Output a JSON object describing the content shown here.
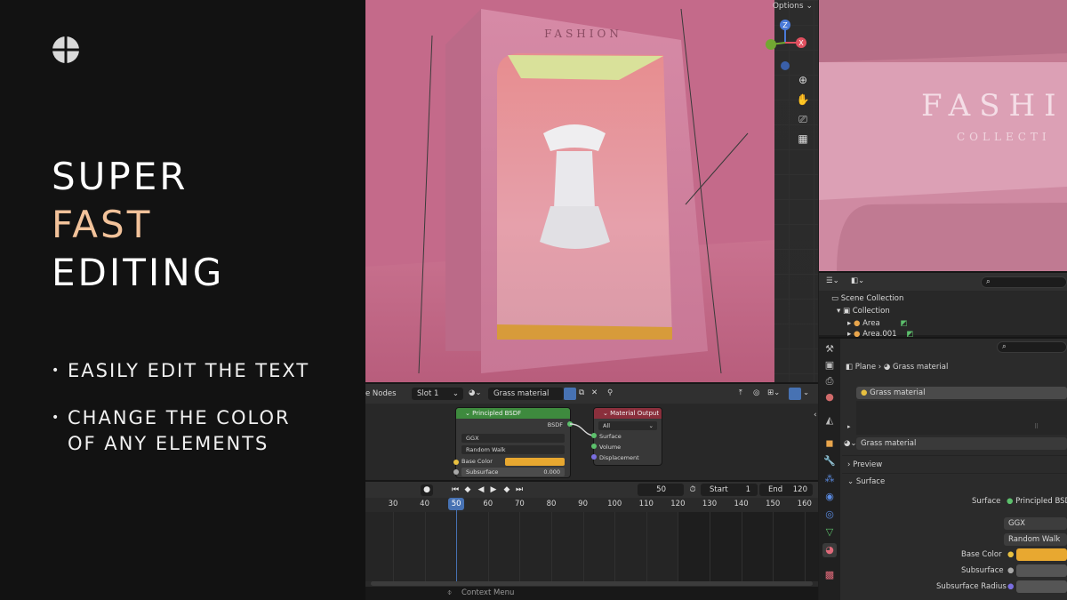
{
  "promo": {
    "headline_1": "SUPER",
    "headline_2": "FAST",
    "headline_3": "EDITING",
    "bullet_dot": "•",
    "bullet_1": "EASILY EDIT THE TEXT",
    "bullet_2_line1": "CHANGE THE COLOR",
    "bullet_2_line2": "OF ANY ELEMENTS",
    "accent_color": "#f2c29a"
  },
  "viewport": {
    "options_label": "Options",
    "box_sign_text": "FASHION",
    "gizmo": {
      "z": "Z",
      "x": "X"
    },
    "nav_icons": [
      "zoom-icon",
      "hand-pan-icon",
      "camera-icon",
      "grid-icon"
    ]
  },
  "render_preview": {
    "sign_line1": "FASHI",
    "sign_line2": "COLLECTI"
  },
  "outliner": {
    "scene_collection": "Scene Collection",
    "collection": "Collection",
    "items": [
      "Area",
      "Area.001"
    ]
  },
  "properties": {
    "breadcrumb_object": "Plane",
    "breadcrumb_material": "Grass material",
    "material_slot": "Grass material",
    "material_name": "Grass material",
    "section_preview": "Preview",
    "section_surface": "Surface",
    "surface_label": "Surface",
    "surface_value": "Principled BSDF",
    "distribution": "GGX",
    "subsurface_method": "Random Walk",
    "base_color_label": "Base Color",
    "base_color": "#e8a830",
    "subsurface_label": "Subsurface",
    "subsurface_radius_label": "Subsurface Radius"
  },
  "node_editor": {
    "header_label": "e Nodes",
    "slot": "Slot 1",
    "material": "Grass material",
    "bsdf_node": {
      "title": "Principled BSDF",
      "output": "BSDF",
      "distribution": "GGX",
      "subsurface_method": "Random Walk",
      "base_color_label": "Base Color",
      "subsurface_label": "Subsurface",
      "subsurface_value": "0.000"
    },
    "output_node": {
      "title": "Material Output",
      "target": "All",
      "inputs": [
        "Surface",
        "Volume",
        "Displacement"
      ]
    }
  },
  "timeline": {
    "current_frame": "50",
    "start_label": "Start",
    "start_value": "1",
    "end_label": "End",
    "end_value": "120",
    "ticks": [
      "30",
      "40",
      "50",
      "60",
      "70",
      "80",
      "90",
      "100",
      "110",
      "120",
      "130",
      "140",
      "150",
      "160"
    ],
    "playhead": "50"
  },
  "statusbar": {
    "context_menu": "Context Menu"
  }
}
